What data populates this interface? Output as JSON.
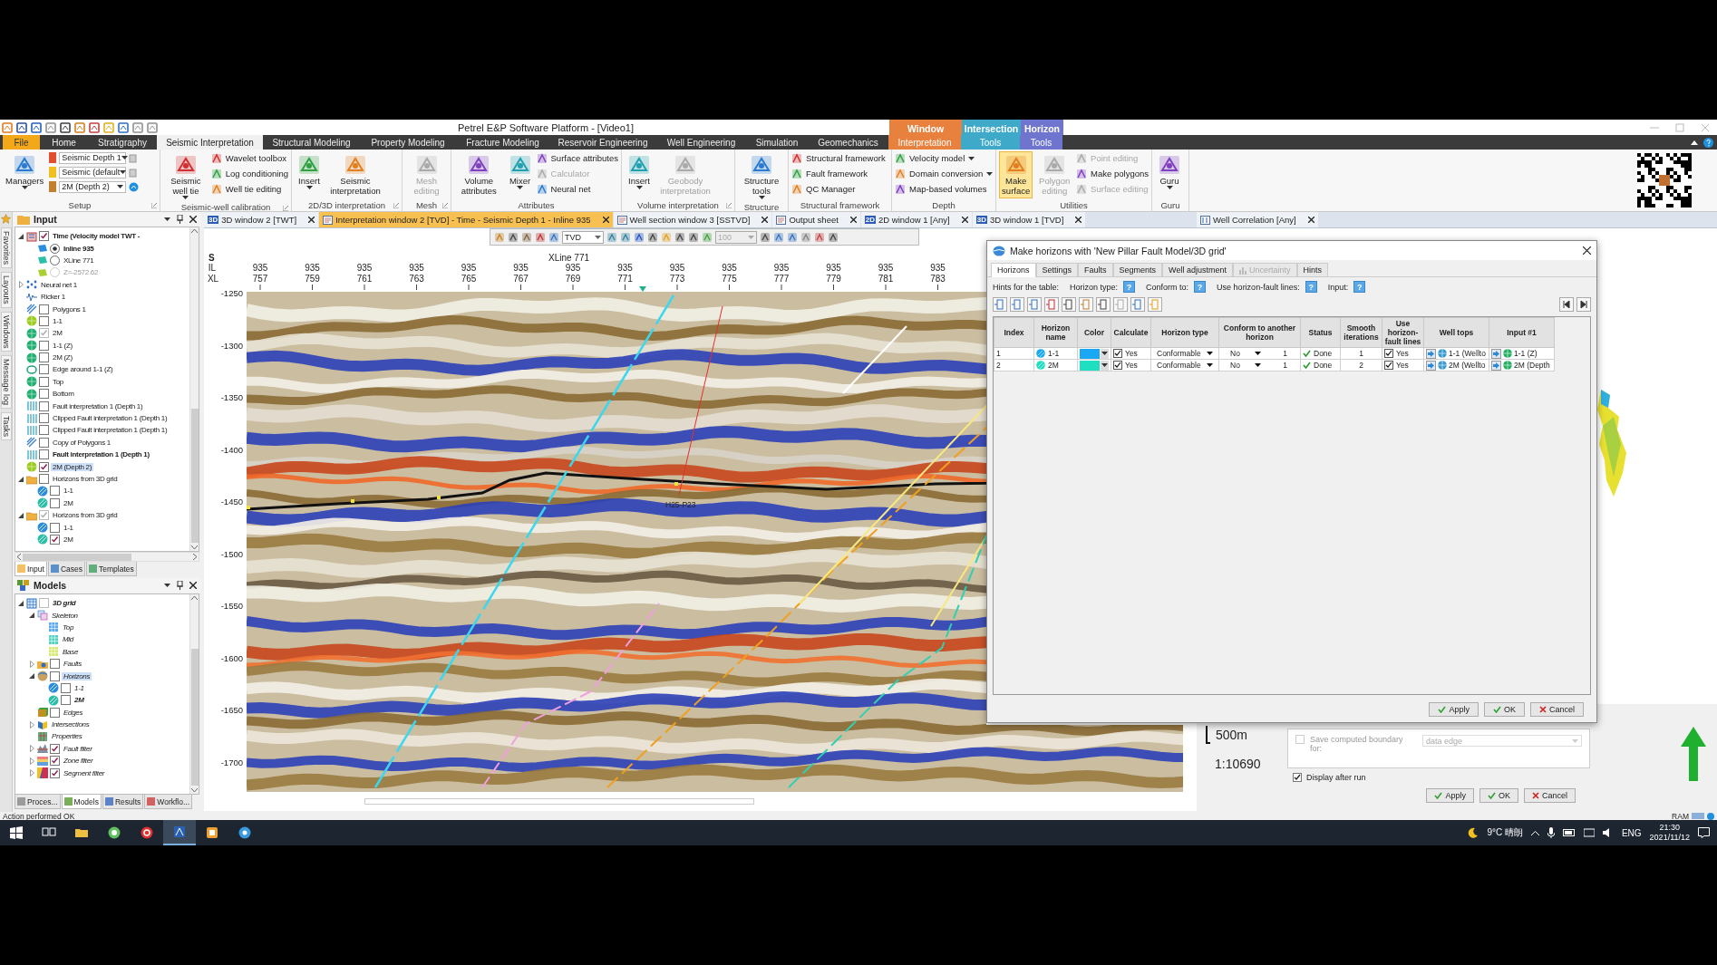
{
  "window": {
    "title": "Petrel E&P Software Platform - [Video1]"
  },
  "context_groups": [
    {
      "label": "Window",
      "color": "#e8803e"
    },
    {
      "label": "Intersection",
      "color": "#3fa9c9"
    },
    {
      "label": "Horizon",
      "color": "#6f74cf"
    }
  ],
  "ribbon_tabs": [
    {
      "label": "File",
      "kind": "file",
      "selected": false
    },
    {
      "label": "Home",
      "kind": "normal",
      "selected": false
    },
    {
      "label": "Stratigraphy",
      "kind": "normal",
      "selected": false
    },
    {
      "label": "Seismic Interpretation",
      "kind": "normal",
      "selected": true
    },
    {
      "label": "Structural Modeling",
      "kind": "normal",
      "selected": false
    },
    {
      "label": "Property Modeling",
      "kind": "normal",
      "selected": false
    },
    {
      "label": "Fracture Modeling",
      "kind": "normal",
      "selected": false
    },
    {
      "label": "Reservoir Engineering",
      "kind": "normal",
      "selected": false
    },
    {
      "label": "Well Engineering",
      "kind": "normal",
      "selected": false
    },
    {
      "label": "Simulation",
      "kind": "normal",
      "selected": false
    },
    {
      "label": "Geomechanics",
      "kind": "normal",
      "selected": false
    },
    {
      "label": "Interpretation",
      "kind": "context",
      "color": "#e8803e",
      "selected": false
    },
    {
      "label": "Tools",
      "kind": "context",
      "color": "#3fa9c9",
      "selected": false
    },
    {
      "label": "Tools",
      "kind": "context",
      "color": "#6f74cf",
      "selected": false
    }
  ],
  "ribbon_groups": [
    {
      "label": "Setup",
      "launcher": true,
      "items": [
        {
          "kind": "large",
          "label": "Managers",
          "dropdown": true,
          "disabled": false,
          "active": false
        },
        {
          "kind": "combos",
          "values": [
            "Seismic Depth 1",
            "Seismic (default",
            "2M (Depth 2)"
          ]
        }
      ]
    },
    {
      "label": "Seismic-well calibration",
      "launcher": true,
      "items": [
        {
          "kind": "large",
          "label": "Seismic well tie",
          "dropdown": true,
          "disabled": false,
          "active": false
        },
        {
          "kind": "smalls",
          "items": [
            {
              "label": "Wavelet toolbox",
              "disabled": false,
              "dropdown": false
            },
            {
              "label": "Log conditioning",
              "disabled": false,
              "dropdown": false
            },
            {
              "label": "Well tie editing",
              "disabled": false,
              "dropdown": false
            }
          ]
        }
      ]
    },
    {
      "label": "2D/3D interpretation",
      "launcher": true,
      "items": [
        {
          "kind": "large",
          "label": "Insert",
          "dropdown": true,
          "disabled": false,
          "active": false
        },
        {
          "kind": "large",
          "label": "Seismic interpretation",
          "dropdown": false,
          "disabled": false,
          "active": false
        }
      ]
    },
    {
      "label": "Mesh",
      "launcher": true,
      "items": [
        {
          "kind": "large",
          "label": "Mesh editing",
          "dropdown": false,
          "disabled": true,
          "active": false
        }
      ]
    },
    {
      "label": "Attributes",
      "launcher": false,
      "items": [
        {
          "kind": "large",
          "label": "Volume attributes",
          "dropdown": false,
          "disabled": false,
          "active": false
        },
        {
          "kind": "large",
          "label": "Mixer",
          "dropdown": true,
          "disabled": false,
          "active": false
        },
        {
          "kind": "smalls",
          "items": [
            {
              "label": "Surface attributes",
              "disabled": false,
              "dropdown": false
            },
            {
              "label": "Calculator",
              "disabled": true,
              "dropdown": false
            },
            {
              "label": "Neural net",
              "disabled": false,
              "dropdown": false
            }
          ]
        }
      ]
    },
    {
      "label": "Volume interpretation",
      "launcher": true,
      "items": [
        {
          "kind": "large",
          "label": "Insert",
          "dropdown": true,
          "disabled": false,
          "active": false
        },
        {
          "kind": "large",
          "label": "Geobody interpretation",
          "dropdown": false,
          "disabled": true,
          "active": false
        }
      ]
    },
    {
      "label": "Structure",
      "launcher": false,
      "items": [
        {
          "kind": "large",
          "label": "Structure tools",
          "dropdown": true,
          "disabled": false,
          "active": false
        }
      ]
    },
    {
      "label": "Structural framework",
      "launcher": false,
      "items": [
        {
          "kind": "smalls",
          "items": [
            {
              "label": "Structural framework",
              "disabled": false,
              "dropdown": false
            },
            {
              "label": "Fault framework",
              "disabled": false,
              "dropdown": false
            },
            {
              "label": "QC Manager",
              "disabled": false,
              "dropdown": false
            }
          ]
        }
      ]
    },
    {
      "label": "Depth",
      "launcher": false,
      "items": [
        {
          "kind": "smalls",
          "items": [
            {
              "label": "Velocity model",
              "disabled": false,
              "dropdown": true
            },
            {
              "label": "Domain conversion",
              "disabled": false,
              "dropdown": true
            },
            {
              "label": "Map-based volumes",
              "disabled": false,
              "dropdown": false
            }
          ]
        }
      ]
    },
    {
      "label": "Utilities",
      "launcher": false,
      "items": [
        {
          "kind": "large",
          "label": "Make surface",
          "dropdown": false,
          "disabled": false,
          "active": true
        },
        {
          "kind": "large",
          "label": "Polygon editing",
          "dropdown": false,
          "disabled": true,
          "active": false
        },
        {
          "kind": "smalls",
          "items": [
            {
              "label": "Point editing",
              "disabled": true,
              "dropdown": false
            },
            {
              "label": "Make polygons",
              "disabled": false,
              "dropdown": false
            },
            {
              "label": "Surface editing",
              "disabled": true,
              "dropdown": false
            }
          ]
        }
      ]
    },
    {
      "label": "Guru",
      "launcher": false,
      "items": [
        {
          "kind": "large",
          "label": "Guru",
          "dropdown": true,
          "disabled": false,
          "active": false
        }
      ]
    }
  ],
  "side_tabs": [
    "Favorites",
    "Layouts",
    "Windows",
    "Message log",
    "Tasks"
  ],
  "input_panel": {
    "title": "Input",
    "items": [
      {
        "label": "Time (Velocity model TWT -",
        "kind": "volume",
        "checked": true,
        "expanded": true,
        "bold": true,
        "selected": false,
        "children": [
          {
            "label": "Inline 935",
            "kind": "plane",
            "color": "#2a8de0",
            "checked": true,
            "bold": true,
            "disabled": false,
            "selected": false
          },
          {
            "label": "XLine 771",
            "kind": "plane",
            "color": "#2cc0a8",
            "checked": false,
            "bold": false,
            "disabled": false,
            "selected": false
          },
          {
            "label": "Z=-2572.62",
            "kind": "plane",
            "color": "#a8d030",
            "checked": false,
            "bold": false,
            "disabled": true,
            "selected": false
          }
        ]
      },
      {
        "label": "Neural net 1",
        "kind": "neural",
        "expanded": false,
        "selected": false
      },
      {
        "label": "Ricker 1",
        "kind": "wavelet",
        "selected": false
      },
      {
        "label": "Polygons 1",
        "kind": "polygon",
        "checked": false,
        "selected": false
      },
      {
        "label": "1-1",
        "kind": "surface",
        "color": "#9ccc20",
        "checked": false,
        "selected": false
      },
      {
        "label": "2M",
        "kind": "surface",
        "color": "#20b070",
        "checked": true,
        "disabled": true,
        "selected": false
      },
      {
        "label": "1-1 (Z)",
        "kind": "surface",
        "color": "#20b070",
        "checked": false,
        "selected": false
      },
      {
        "label": "2M (Z)",
        "kind": "surface",
        "color": "#20b070",
        "checked": false,
        "selected": false
      },
      {
        "label": "Edge around 1-1 (Z)",
        "kind": "edge",
        "checked": false,
        "selected": false
      },
      {
        "label": "Top",
        "kind": "surface",
        "color": "#20b070",
        "checked": false,
        "selected": false
      },
      {
        "label": "Bottom",
        "kind": "surface",
        "color": "#20b070",
        "checked": false,
        "selected": false
      },
      {
        "label": "Fault interpretation 1 (Depth 1)",
        "kind": "fault",
        "checked": false,
        "selected": false
      },
      {
        "label": "Clipped Fault interpretation 1 (Depth 1)",
        "kind": "fault",
        "checked": false,
        "selected": false
      },
      {
        "label": "Clipped Fault interpretation 1 (Depth 1)",
        "kind": "fault",
        "checked": false,
        "selected": false
      },
      {
        "label": "Copy of Polygons 1",
        "kind": "polygon",
        "checked": false,
        "selected": false
      },
      {
        "label": "Fault interpretation 1 (Depth 1)",
        "kind": "fault",
        "checked": false,
        "bold": true,
        "selected": false
      },
      {
        "label": "2M (Depth 2)",
        "kind": "surface",
        "color": "#9ccc20",
        "checked": true,
        "selected": true
      },
      {
        "label": "Horizons from 3D grid",
        "kind": "folder",
        "checked": false,
        "expanded": true,
        "selected": false,
        "children": [
          {
            "label": "1-1",
            "kind": "horizon",
            "color": "#2a8de0",
            "checked": false,
            "selected": false
          },
          {
            "label": "2M",
            "kind": "horizon",
            "color": "#2cc0a8",
            "checked": false,
            "selected": false
          }
        ]
      },
      {
        "label": "Horizons from 3D grid",
        "kind": "folder",
        "checked": true,
        "disabled": true,
        "expanded": true,
        "selected": false,
        "children": [
          {
            "label": "1-1",
            "kind": "horizon",
            "color": "#2a8de0",
            "checked": false,
            "selected": false
          },
          {
            "label": "2M",
            "kind": "horizon",
            "color": "#2cc0a8",
            "checked": true,
            "selected": false
          }
        ]
      }
    ],
    "tabs": [
      {
        "label": "Input",
        "selected": true
      },
      {
        "label": "Cases",
        "selected": false
      },
      {
        "label": "Templates",
        "selected": false
      }
    ]
  },
  "models_panel": {
    "title": "Models",
    "items": [
      {
        "label": "3D grid",
        "kind": "grid",
        "checked": false,
        "disabled": true,
        "expanded": true,
        "bold": true,
        "selected": false,
        "children": [
          {
            "label": "Skeleton",
            "kind": "skeleton",
            "expanded": true,
            "selected": false,
            "children": [
              {
                "label": "Top",
                "kind": "layer",
                "color": "#5aa8f0",
                "selected": false
              },
              {
                "label": "Mid",
                "kind": "layer",
                "color": "#50d0c0",
                "selected": false
              },
              {
                "label": "Base",
                "kind": "layer",
                "color": "#d8e870",
                "selected": false
              }
            ]
          },
          {
            "label": "Faults",
            "kind": "faults",
            "checked": false,
            "expanded": false,
            "selected": false
          },
          {
            "label": "Horizons",
            "kind": "horizons",
            "checked": false,
            "expanded": true,
            "selected": true,
            "children": [
              {
                "label": "1-1",
                "kind": "horizon",
                "color": "#2a8de0",
                "checked": false,
                "selected": false
              },
              {
                "label": "2M",
                "kind": "horizon",
                "color": "#2cc0a8",
                "checked": false,
                "bold": true,
                "selected": false
              }
            ]
          },
          {
            "label": "Edges",
            "kind": "edges",
            "checked": false,
            "selected": false
          },
          {
            "label": "Intersections",
            "kind": "intersections",
            "expanded": false,
            "selected": false
          },
          {
            "label": "Properties",
            "kind": "properties",
            "selected": false
          },
          {
            "label": "Fault filter",
            "kind": "filter",
            "checked": true,
            "expanded": false,
            "selected": false
          },
          {
            "label": "Zone filter",
            "kind": "zone",
            "checked": true,
            "expanded": false,
            "selected": false
          },
          {
            "label": "Segment filter",
            "kind": "segment",
            "checked": true,
            "expanded": false,
            "selected": false
          }
        ]
      }
    ],
    "tabs": [
      {
        "label": "Proces...",
        "selected": false
      },
      {
        "label": "Models",
        "selected": true
      },
      {
        "label": "Results",
        "selected": false
      },
      {
        "label": "Workflo...",
        "selected": false
      }
    ]
  },
  "doc_tabs": [
    {
      "badge": "3D",
      "label": "3D window 2 [TWT]",
      "selected": false
    },
    {
      "label": "Interpretation window 2 [TVD] - Time - Seismic Depth 1 - Inline 935",
      "selected": true
    },
    {
      "label": "Well section window 3 [SSTVD]",
      "selected": false
    },
    {
      "label": "Output sheet",
      "selected": false
    },
    {
      "badge": "2D",
      "label": "2D window 1 [Any]",
      "selected": false
    },
    {
      "badge": "3D",
      "label": "3D window 1 [TVD]",
      "selected": false
    }
  ],
  "view_toolbar": {
    "domain": "TVD",
    "zoom": "100"
  },
  "seismic": {
    "direction": "S",
    "crossline": "XLine 771",
    "il_label": "IL",
    "xl_label": "XL",
    "ticks": [
      {
        "il": "935",
        "xl": "757"
      },
      {
        "il": "935",
        "xl": "759"
      },
      {
        "il": "935",
        "xl": "761"
      },
      {
        "il": "935",
        "xl": "763"
      },
      {
        "il": "935",
        "xl": "765"
      },
      {
        "il": "935",
        "xl": "767"
      },
      {
        "il": "935",
        "xl": "769"
      },
      {
        "il": "935",
        "xl": "771"
      },
      {
        "il": "935",
        "xl": "773"
      },
      {
        "il": "935",
        "xl": "775"
      },
      {
        "il": "935",
        "xl": "777"
      },
      {
        "il": "935",
        "xl": "779"
      },
      {
        "il": "935",
        "xl": "781"
      },
      {
        "il": "935",
        "xl": "783"
      }
    ],
    "depths": [
      "-1250",
      "-1300",
      "-1350",
      "-1400",
      "-1450",
      "-1500",
      "-1550",
      "-1600",
      "-1650",
      "-1700"
    ],
    "well_label": "H25-P23"
  },
  "well_pane": {
    "tab": "Well Correlation [Any]",
    "scale": "500m",
    "ratio": "1:10690",
    "save_boundary": {
      "label": "Save computed boundary for:",
      "checked": false,
      "value": "data edge"
    },
    "display_after_run": {
      "label": "Display after run",
      "checked": true
    },
    "buttons": [
      "Apply",
      "OK",
      "Cancel"
    ]
  },
  "dialog": {
    "title": "Make horizons with 'New Pillar Fault Model/3D grid'",
    "tabs": [
      {
        "label": "Horizons",
        "selected": true,
        "disabled": false
      },
      {
        "label": "Settings",
        "selected": false,
        "disabled": false
      },
      {
        "label": "Faults",
        "selected": false,
        "disabled": false
      },
      {
        "label": "Segments",
        "selected": false,
        "disabled": false
      },
      {
        "label": "Well adjustment",
        "selected": false,
        "disabled": false
      },
      {
        "label": "Uncertainty",
        "selected": false,
        "disabled": true
      },
      {
        "label": "Hints",
        "selected": false,
        "disabled": false
      }
    ],
    "hints_label": "Hints for the table:",
    "hints": [
      {
        "label": "Horizon type:",
        "button": "?"
      },
      {
        "label": "Conform to:",
        "button": "?"
      },
      {
        "label": "Use horizon-fault lines:",
        "button": "?"
      },
      {
        "label": "Input:",
        "button": "?"
      }
    ],
    "columns": [
      "Index",
      "Horizon name",
      "Color",
      "Calculate",
      "Horizon type",
      "Conform to another horizon",
      "Status",
      "Smooth iterations",
      "Use horizon-fault lines",
      "Well tops",
      "Input #1"
    ],
    "rows": [
      {
        "index": "1",
        "name": "1-1",
        "color": "#1aa8f5",
        "calculate": true,
        "calculate_label": "Yes",
        "type": "Conformable",
        "conform": "No",
        "conform_value": "1",
        "status": "Done",
        "smooth": "1",
        "use_lines": true,
        "use_lines_label": "Yes",
        "well_tops": "1-1 (Wellto",
        "input": "1-1 (Z)"
      },
      {
        "index": "2",
        "name": "2M",
        "color": "#1ee0c0",
        "calculate": true,
        "calculate_label": "Yes",
        "type": "Conformable",
        "conform": "No",
        "conform_value": "1",
        "status": "Done",
        "smooth": "2",
        "use_lines": true,
        "use_lines_label": "Yes",
        "well_tops": "2M (Wellto",
        "input": "2M (Depth"
      }
    ],
    "buttons": [
      "Apply",
      "OK",
      "Cancel"
    ]
  },
  "status_bar": {
    "message": "Action performed OK",
    "ram": "RAM"
  },
  "taskbar": {
    "weather": "9°C 晴朗",
    "language": "ENG",
    "time": "21:30",
    "date": "2021/11/12"
  }
}
